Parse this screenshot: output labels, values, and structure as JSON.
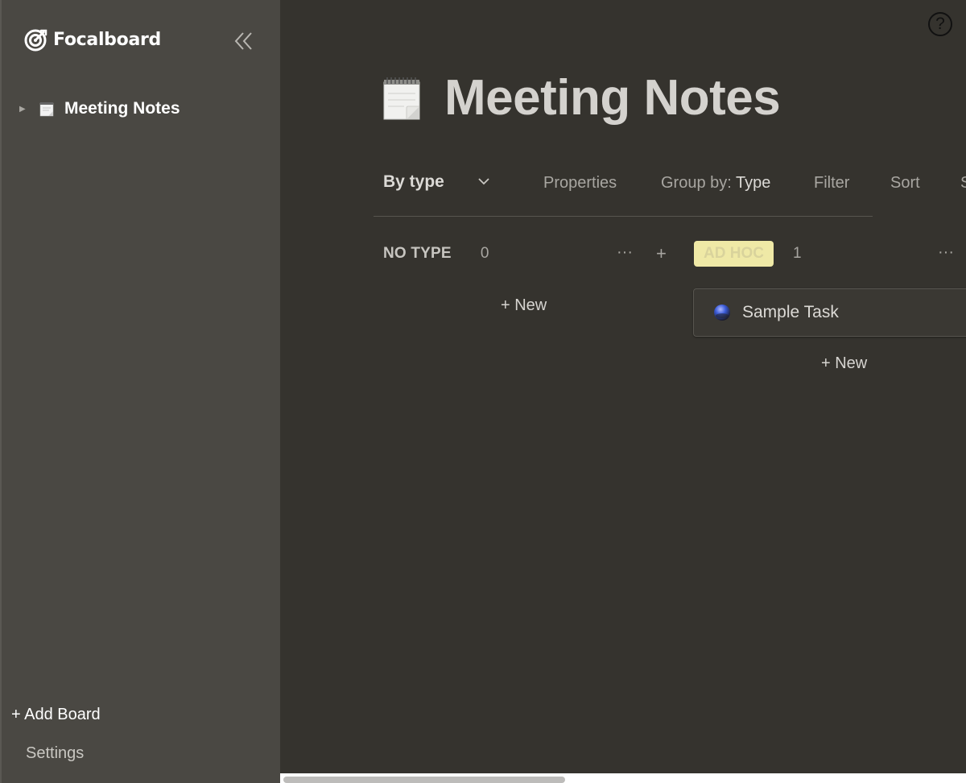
{
  "sidebar": {
    "logo_text": "Focalboard",
    "boards": [
      {
        "label": "Meeting Notes",
        "emoji": "notepad-icon"
      }
    ],
    "add_board_label": "+ Add Board",
    "settings_label": "Settings"
  },
  "help_label": "?",
  "board": {
    "title": "Meeting Notes",
    "emoji": "notepad-icon"
  },
  "toolbar": {
    "view_name": "By type",
    "properties_label": "Properties",
    "group_by_prefix": "Group by:",
    "group_by_value": "Type",
    "filter_label": "Filter",
    "sort_label": "Sort",
    "search_partial": "S"
  },
  "columns": [
    {
      "title": "NO TYPE",
      "count": "0",
      "more": "···",
      "add": "+",
      "new_label": "+ New",
      "cards": []
    },
    {
      "title": "AD HOC",
      "count": "1",
      "more": "···",
      "new_label": "+ New",
      "tag_color": "#efe9a6",
      "cards": [
        {
          "title": "Sample Task",
          "icon": "ball-icon"
        }
      ]
    }
  ],
  "colors": {
    "sidebar_bg": "#4a4843",
    "main_bg": "#35332e",
    "tag_yellow": "#efe9a6"
  }
}
